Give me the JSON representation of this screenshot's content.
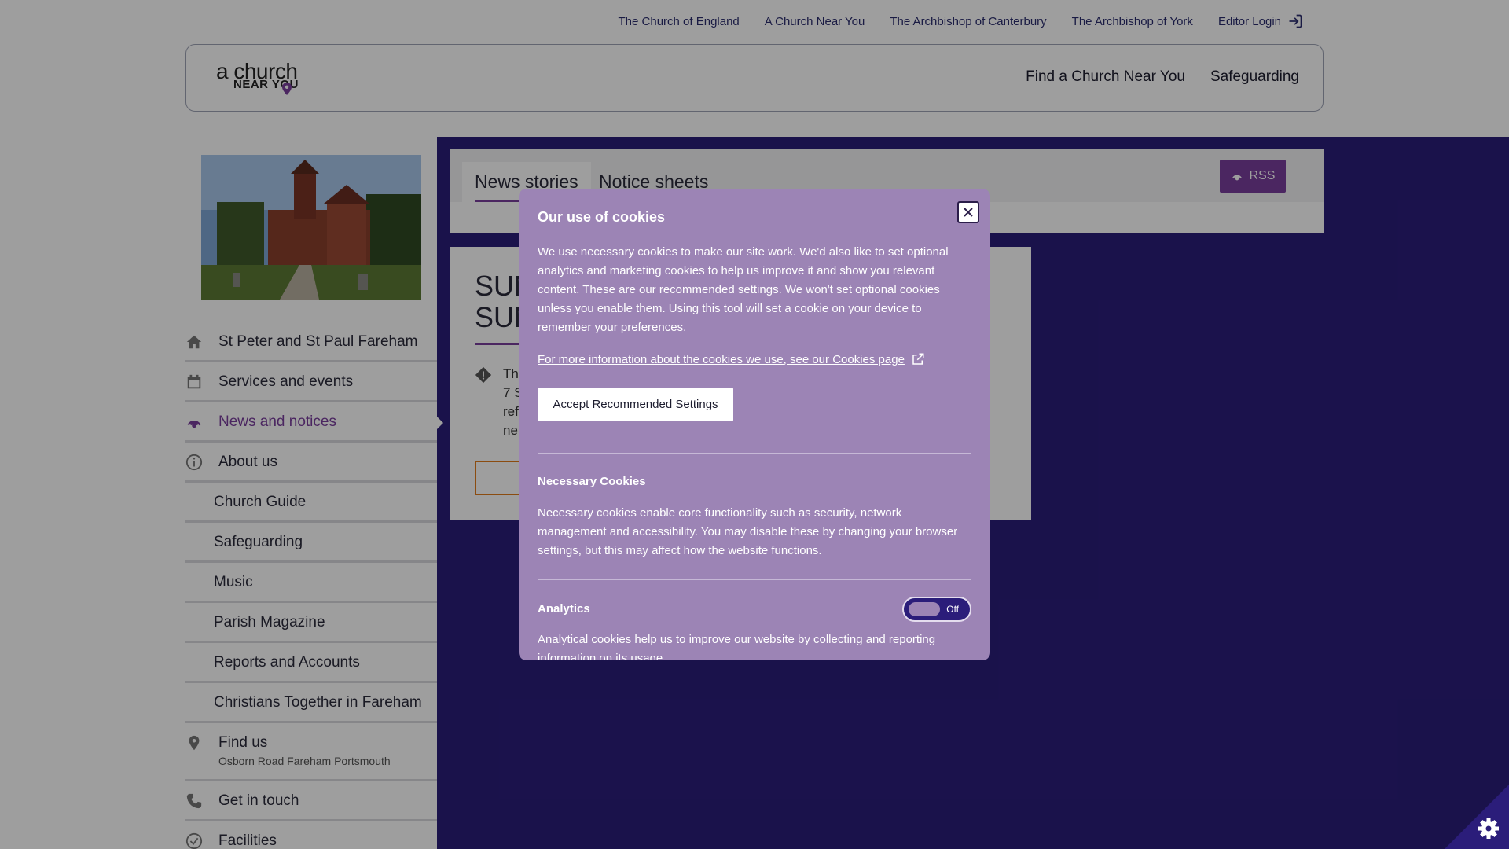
{
  "util_links": {
    "church_of_england": "The Church of England",
    "a_church_near_you": "A Church Near You",
    "archbishop_canterbury": "The Archbishop of Canterbury",
    "archbishop_york": "The Archbishop of York",
    "editor_login": "Editor Login"
  },
  "logo": {
    "line1": "a church",
    "line2": "NEAR YOU"
  },
  "header_nav": {
    "find_church": "Find a Church Near You",
    "safeguarding": "Safeguarding"
  },
  "sidebar": {
    "items": [
      {
        "label": "St Peter and St Paul Fareham",
        "icon": "home-icon"
      },
      {
        "label": "Services and events",
        "icon": "calendar-icon"
      },
      {
        "label": "News and notices",
        "icon": "rss-icon",
        "active": true
      },
      {
        "label": "About us",
        "icon": "info-icon"
      },
      {
        "label": "Church Guide"
      },
      {
        "label": "Safeguarding"
      },
      {
        "label": "Music"
      },
      {
        "label": "Parish Magazine"
      },
      {
        "label": "Reports and Accounts"
      },
      {
        "label": "Christians Together in Fareham"
      },
      {
        "label": "Find us",
        "sub": "Osborn Road Fareham Portsmouth",
        "icon": "location-pin-icon"
      },
      {
        "label": "Get in touch",
        "icon": "phone-icon"
      },
      {
        "label": "Facilities",
        "icon": "check-circle-icon"
      }
    ]
  },
  "tabs": {
    "news": "News stories",
    "notices": "Notice sheets",
    "rss": "RSS"
  },
  "post": {
    "title": "SUN\nSUN",
    "body": "Th\n7 S\nref\nne"
  },
  "cookie_modal": {
    "title": "Our use of cookies",
    "intro": "We use necessary cookies to make our site work. We'd also like to set optional analytics and marketing cookies to help us improve it and show you relevant content. These are our recommended settings. We won't set optional cookies unless you enable them. Using this tool will set a cookie on your device to remember your preferences.",
    "more_link": "For more information about the cookies we use, see our Cookies page",
    "accept_label": "Accept Recommended Settings",
    "necessary_title": "Necessary Cookies",
    "necessary_text": "Necessary cookies enable core functionality such as security, network management and accessibility. You may disable these by changing your browser settings, but this may affect how the website functions.",
    "analytics_title": "Analytics",
    "analytics_toggle": "Off",
    "analytics_text": "Analytical cookies help us to improve our website by collecting and reporting information on its usage."
  },
  "colors": {
    "brand_purple": "#7a3e9d",
    "deep_purple": "#2b1d7a",
    "modal_bg": "#9c84b5",
    "accent_orange": "#e07b1a"
  }
}
